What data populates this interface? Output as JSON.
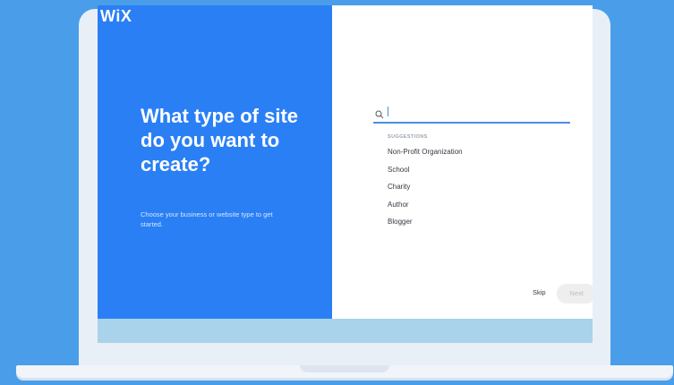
{
  "brand": {
    "logo": "WiX",
    "background": "#4a9ee9",
    "accent": "#2a7ff5"
  },
  "intro": {
    "headline": "What type of site do you want to create?",
    "subtext": "Choose your business or website type to get started."
  },
  "search": {
    "icon": "search-icon",
    "value": "",
    "placeholder": ""
  },
  "suggestions": {
    "heading": "SUGGESTIONS",
    "items": [
      {
        "label": "Non-Profit Organization"
      },
      {
        "label": "School"
      },
      {
        "label": "Charity"
      },
      {
        "label": "Author"
      },
      {
        "label": "Blogger"
      }
    ]
  },
  "actions": {
    "skip_label": "Skip",
    "next_label": "Next"
  }
}
